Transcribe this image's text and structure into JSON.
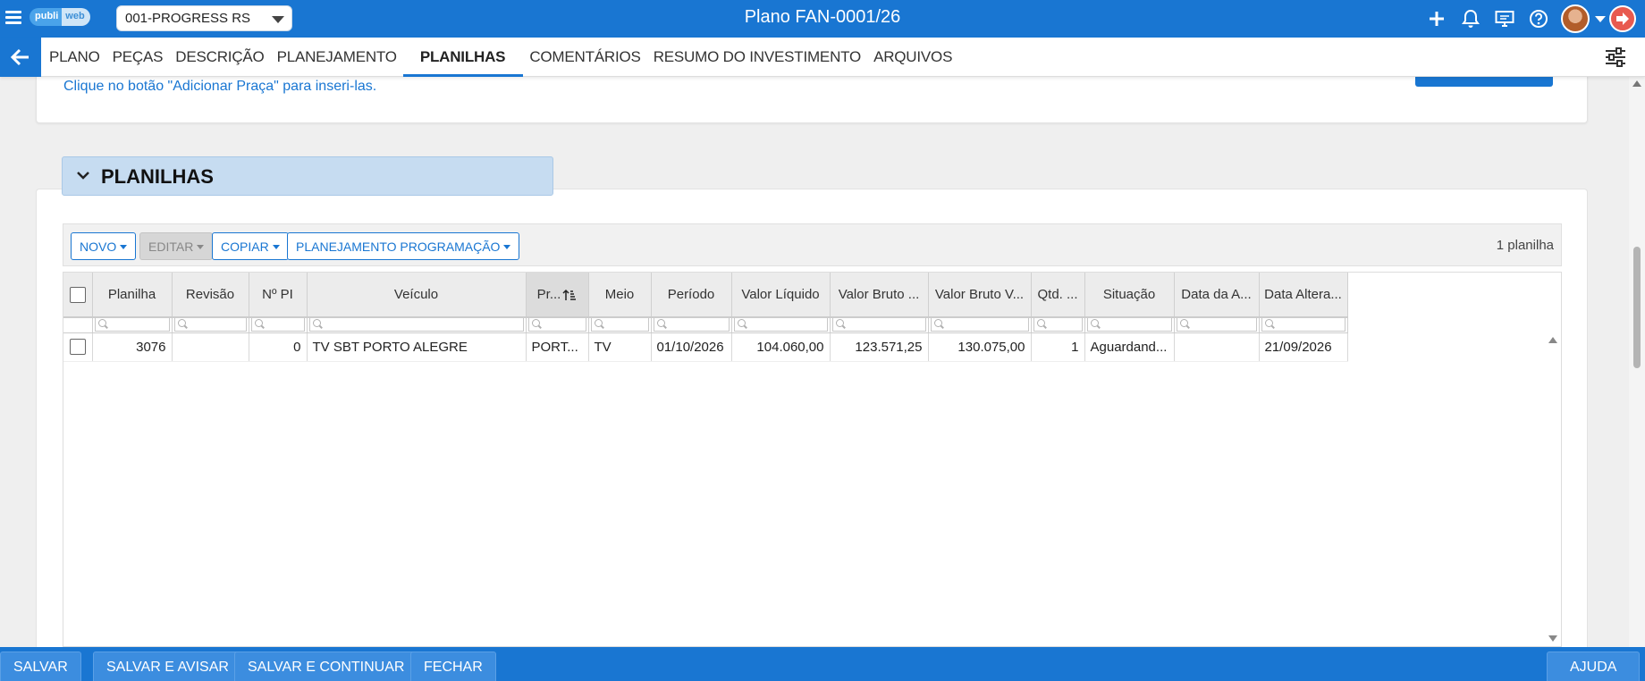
{
  "header": {
    "logo_left": "publi",
    "logo_right": "web",
    "client_select": "001-PROGRESS RS",
    "title": "Plano FAN-0001/26",
    "icons": [
      "plus-icon",
      "bell-icon",
      "monitor-icon",
      "help-icon",
      "avatar",
      "logout-icon"
    ]
  },
  "tabs": [
    {
      "label": "PLANO"
    },
    {
      "label": "PEÇAS"
    },
    {
      "label": "DESCRIÇÃO"
    },
    {
      "label": "PLANEJAMENTO"
    },
    {
      "label": "PLANILHAS",
      "active": true
    },
    {
      "label": "COMENTÁRIOS"
    },
    {
      "label": "RESUMO DO INVESTIMENTO"
    },
    {
      "label": "ARQUIVOS"
    }
  ],
  "top_card": {
    "hint": "Clique no botão \"Adicionar Praça\" para inseri-las."
  },
  "section": {
    "title": "PLANILHAS"
  },
  "toolbar": {
    "novo": "NOVO",
    "editar": "EDITAR",
    "copiar": "COPIAR",
    "planejamento": "PLANEJAMENTO PROGRAMAÇÃO",
    "count": "1 planilha"
  },
  "grid": {
    "columns": [
      "Planilha",
      "Revisão",
      "Nº PI",
      "Veículo",
      "Pr...",
      "Meio",
      "Período",
      "Valor Líquido",
      "Valor Bruto ...",
      "Valor Bruto V...",
      "Qtd. ...",
      "Situação",
      "Data da A...",
      "Data Altera..."
    ],
    "rows": [
      {
        "planilha": "3076",
        "revisao": "",
        "npi": "0",
        "veiculo": "TV SBT PORTO ALEGRE",
        "praca": "PORT...",
        "meio": "TV",
        "periodo": "01/10/2026",
        "valor_liquido": "104.060,00",
        "valor_bruto": "123.571,25",
        "valor_bruto_v": "130.075,00",
        "qtd": "1",
        "situacao": "Aguardand...",
        "data_a": "",
        "data_alteracao": "21/09/2026"
      }
    ]
  },
  "footer": {
    "salvar": "SALVAR",
    "salvar_avisar": "SALVAR E AVISAR",
    "salvar_continuar": "SALVAR E CONTINUAR",
    "fechar": "FECHAR",
    "ajuda": "AJUDA"
  },
  "colors": {
    "primary": "#1976d2",
    "section_header": "#c6dcf1"
  }
}
